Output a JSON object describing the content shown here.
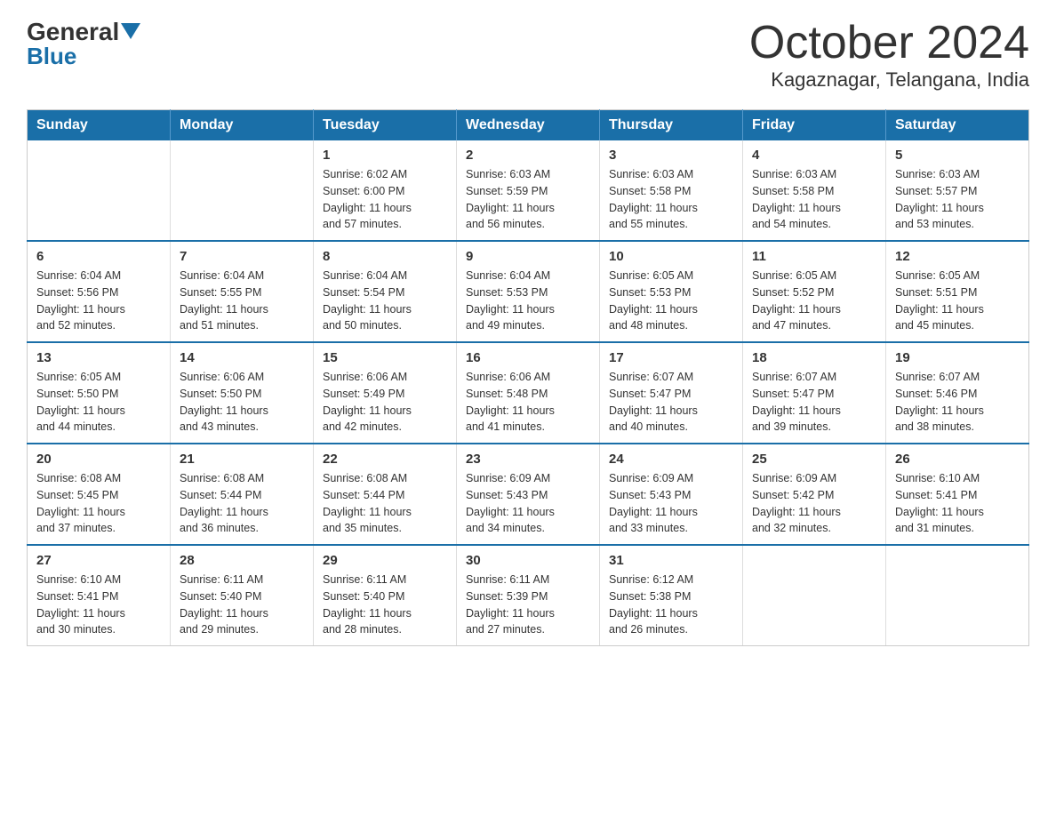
{
  "header": {
    "logo_text1": "General",
    "logo_text2": "Blue",
    "month_title": "October 2024",
    "location": "Kagaznagar, Telangana, India"
  },
  "days_of_week": [
    "Sunday",
    "Monday",
    "Tuesday",
    "Wednesday",
    "Thursday",
    "Friday",
    "Saturday"
  ],
  "weeks": [
    [
      {
        "day": "",
        "info": ""
      },
      {
        "day": "",
        "info": ""
      },
      {
        "day": "1",
        "info": "Sunrise: 6:02 AM\nSunset: 6:00 PM\nDaylight: 11 hours\nand 57 minutes."
      },
      {
        "day": "2",
        "info": "Sunrise: 6:03 AM\nSunset: 5:59 PM\nDaylight: 11 hours\nand 56 minutes."
      },
      {
        "day": "3",
        "info": "Sunrise: 6:03 AM\nSunset: 5:58 PM\nDaylight: 11 hours\nand 55 minutes."
      },
      {
        "day": "4",
        "info": "Sunrise: 6:03 AM\nSunset: 5:58 PM\nDaylight: 11 hours\nand 54 minutes."
      },
      {
        "day": "5",
        "info": "Sunrise: 6:03 AM\nSunset: 5:57 PM\nDaylight: 11 hours\nand 53 minutes."
      }
    ],
    [
      {
        "day": "6",
        "info": "Sunrise: 6:04 AM\nSunset: 5:56 PM\nDaylight: 11 hours\nand 52 minutes."
      },
      {
        "day": "7",
        "info": "Sunrise: 6:04 AM\nSunset: 5:55 PM\nDaylight: 11 hours\nand 51 minutes."
      },
      {
        "day": "8",
        "info": "Sunrise: 6:04 AM\nSunset: 5:54 PM\nDaylight: 11 hours\nand 50 minutes."
      },
      {
        "day": "9",
        "info": "Sunrise: 6:04 AM\nSunset: 5:53 PM\nDaylight: 11 hours\nand 49 minutes."
      },
      {
        "day": "10",
        "info": "Sunrise: 6:05 AM\nSunset: 5:53 PM\nDaylight: 11 hours\nand 48 minutes."
      },
      {
        "day": "11",
        "info": "Sunrise: 6:05 AM\nSunset: 5:52 PM\nDaylight: 11 hours\nand 47 minutes."
      },
      {
        "day": "12",
        "info": "Sunrise: 6:05 AM\nSunset: 5:51 PM\nDaylight: 11 hours\nand 45 minutes."
      }
    ],
    [
      {
        "day": "13",
        "info": "Sunrise: 6:05 AM\nSunset: 5:50 PM\nDaylight: 11 hours\nand 44 minutes."
      },
      {
        "day": "14",
        "info": "Sunrise: 6:06 AM\nSunset: 5:50 PM\nDaylight: 11 hours\nand 43 minutes."
      },
      {
        "day": "15",
        "info": "Sunrise: 6:06 AM\nSunset: 5:49 PM\nDaylight: 11 hours\nand 42 minutes."
      },
      {
        "day": "16",
        "info": "Sunrise: 6:06 AM\nSunset: 5:48 PM\nDaylight: 11 hours\nand 41 minutes."
      },
      {
        "day": "17",
        "info": "Sunrise: 6:07 AM\nSunset: 5:47 PM\nDaylight: 11 hours\nand 40 minutes."
      },
      {
        "day": "18",
        "info": "Sunrise: 6:07 AM\nSunset: 5:47 PM\nDaylight: 11 hours\nand 39 minutes."
      },
      {
        "day": "19",
        "info": "Sunrise: 6:07 AM\nSunset: 5:46 PM\nDaylight: 11 hours\nand 38 minutes."
      }
    ],
    [
      {
        "day": "20",
        "info": "Sunrise: 6:08 AM\nSunset: 5:45 PM\nDaylight: 11 hours\nand 37 minutes."
      },
      {
        "day": "21",
        "info": "Sunrise: 6:08 AM\nSunset: 5:44 PM\nDaylight: 11 hours\nand 36 minutes."
      },
      {
        "day": "22",
        "info": "Sunrise: 6:08 AM\nSunset: 5:44 PM\nDaylight: 11 hours\nand 35 minutes."
      },
      {
        "day": "23",
        "info": "Sunrise: 6:09 AM\nSunset: 5:43 PM\nDaylight: 11 hours\nand 34 minutes."
      },
      {
        "day": "24",
        "info": "Sunrise: 6:09 AM\nSunset: 5:43 PM\nDaylight: 11 hours\nand 33 minutes."
      },
      {
        "day": "25",
        "info": "Sunrise: 6:09 AM\nSunset: 5:42 PM\nDaylight: 11 hours\nand 32 minutes."
      },
      {
        "day": "26",
        "info": "Sunrise: 6:10 AM\nSunset: 5:41 PM\nDaylight: 11 hours\nand 31 minutes."
      }
    ],
    [
      {
        "day": "27",
        "info": "Sunrise: 6:10 AM\nSunset: 5:41 PM\nDaylight: 11 hours\nand 30 minutes."
      },
      {
        "day": "28",
        "info": "Sunrise: 6:11 AM\nSunset: 5:40 PM\nDaylight: 11 hours\nand 29 minutes."
      },
      {
        "day": "29",
        "info": "Sunrise: 6:11 AM\nSunset: 5:40 PM\nDaylight: 11 hours\nand 28 minutes."
      },
      {
        "day": "30",
        "info": "Sunrise: 6:11 AM\nSunset: 5:39 PM\nDaylight: 11 hours\nand 27 minutes."
      },
      {
        "day": "31",
        "info": "Sunrise: 6:12 AM\nSunset: 5:38 PM\nDaylight: 11 hours\nand 26 minutes."
      },
      {
        "day": "",
        "info": ""
      },
      {
        "day": "",
        "info": ""
      }
    ]
  ],
  "colors": {
    "header_bg": "#1a6fa8",
    "header_text": "#ffffff",
    "border_blue": "#1a6fa8",
    "text_dark": "#333333",
    "blue_accent": "#1a6fa8"
  }
}
